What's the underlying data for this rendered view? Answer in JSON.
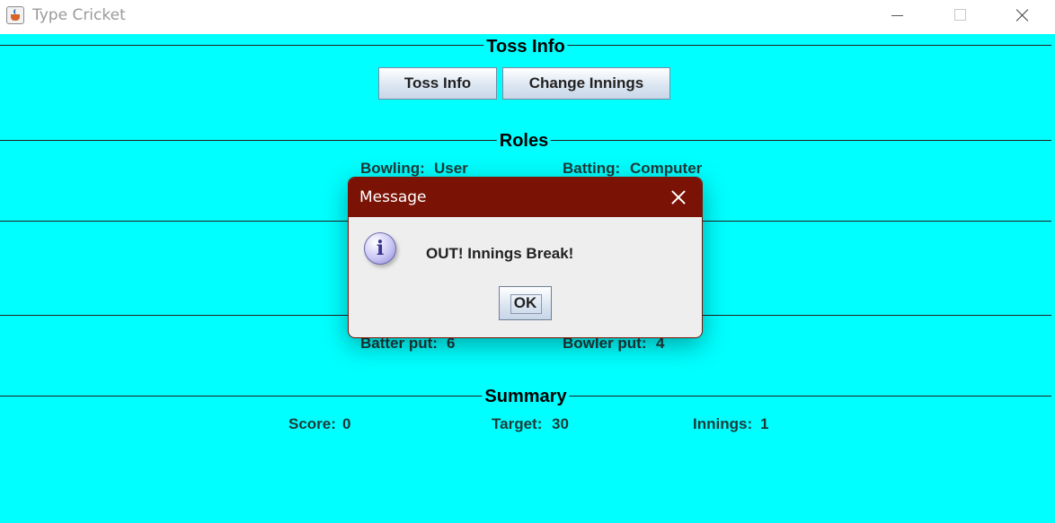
{
  "window": {
    "title": "Type Cricket",
    "icons": {
      "app": "java-cup-icon",
      "minimize": "minimize-icon",
      "maximize": "maximize-icon",
      "close": "close-icon"
    }
  },
  "colors": {
    "background": "#00ffff",
    "dialog_header": "#7a1306"
  },
  "toss": {
    "section_title": "Toss Info",
    "toss_button": "Toss Info",
    "change_innings_button": "Change Innings"
  },
  "roles": {
    "section_title": "Roles",
    "bowling_label": "Bowling:",
    "bowling_value": "User",
    "batting_label": "Batting:",
    "batting_value": "Computer"
  },
  "play": {
    "batter_label": "Batter put:",
    "batter_value": "6",
    "bowler_label": "Bowler put:",
    "bowler_value": "4"
  },
  "summary": {
    "section_title": "Summary",
    "score_label": "Score:",
    "score_value": "0",
    "target_label": "Target:",
    "target_value": "30",
    "innings_label": "Innings:",
    "innings_value": "1"
  },
  "dialog": {
    "title": "Message",
    "message": "OUT! Innings Break!",
    "ok_button": "OK",
    "icon": "information-icon"
  }
}
